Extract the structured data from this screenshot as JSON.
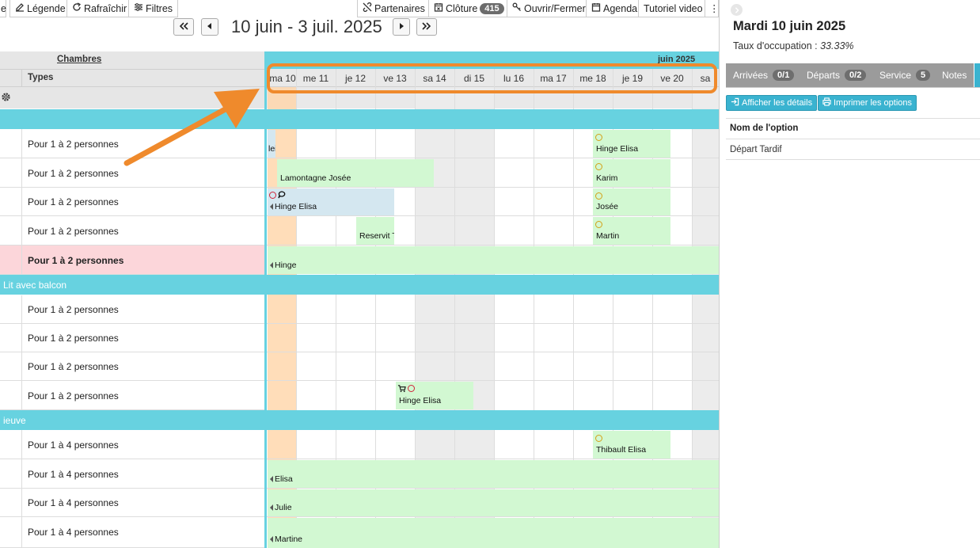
{
  "toolbar": {
    "partial_label": "e",
    "legend": "Légende",
    "refresh": "Rafraîchir",
    "filters": "Filtres",
    "partners": "Partenaires",
    "closure": "Clôture",
    "closure_count": "415",
    "open_close": "Ouvrir/Fermer",
    "agenda": "Agenda",
    "tutorial": "Tutoriel video",
    "more": "⋮"
  },
  "nav": {
    "range": "10 juin - 3 juil. 2025"
  },
  "left": {
    "rooms_title": "Chambres",
    "types_title": "Types"
  },
  "grid": {
    "month": "juin 2025",
    "days": [
      "ma 10",
      "me 11",
      "je 12",
      "ve 13",
      "sa 14",
      "di 15",
      "lu 16",
      "ma 17",
      "me 18",
      "je 19",
      "ve 20",
      "sa"
    ]
  },
  "categories": [
    "",
    "Lit avec balcon",
    "ieuve"
  ],
  "rooms": [
    {
      "type": "Pour 1 à 2 personnes"
    },
    {
      "type": "Pour 1 à 2 personnes"
    },
    {
      "type": "Pour 1 à 2 personnes"
    },
    {
      "type": "Pour 1 à 2 personnes"
    },
    {
      "type": "Pour 1 à 2 personnes"
    },
    {
      "type": "Pour 1 à 2 personnes"
    },
    {
      "type": "Pour 1 à 2 personnes"
    },
    {
      "type": "Pour 1 à 2 personnes"
    },
    {
      "type": "Pour 1 à 2 personnes"
    },
    {
      "type": "Pour 1 à 4 personnes"
    },
    {
      "type": "Pour 1 à 4 personnes"
    },
    {
      "type": "Pour 1 à 4 personnes"
    },
    {
      "type": "Pour 1 à 4 personnes"
    }
  ],
  "reservations": {
    "r1a": "lei",
    "r1b": "Hinge Elisa",
    "r2a": "Lamontagne Josée",
    "r2b": "Karim",
    "r3a": "Hinge Elisa",
    "r3b": "Josée",
    "r4a": "Reservit Te",
    "r4b": "Martin",
    "r5a": "Hinge",
    "r9a": "Hinge Elisa",
    "r10a": "Thibault Elisa",
    "r11a": "Elisa",
    "r12a": "Julie",
    "r13a": "Martine"
  },
  "panel": {
    "date_title": "Mardi 10 juin 2025",
    "occupancy_label": "Taux d'occupation :",
    "occupancy_value": "33.33%",
    "tabs": {
      "arrivals": "Arrivées",
      "arrivals_count": "0/1",
      "departures": "Départs",
      "departures_count": "0/2",
      "service": "Service",
      "service_count": "5",
      "notes": "Notes"
    },
    "show_details": "Afficher les détails",
    "print_options": "Imprimer les options",
    "options_header": "Nom de l'option",
    "options": [
      "Départ Tardif"
    ]
  },
  "colors": {
    "accent_cyan": "#67d2e0",
    "reservation_green": "#d2f8d2",
    "reservation_blue": "#d4e7f0",
    "today_orange": "#ffd4a8",
    "highlight_row": "#fcd6da",
    "annotation_orange": "#ef8a2c"
  }
}
